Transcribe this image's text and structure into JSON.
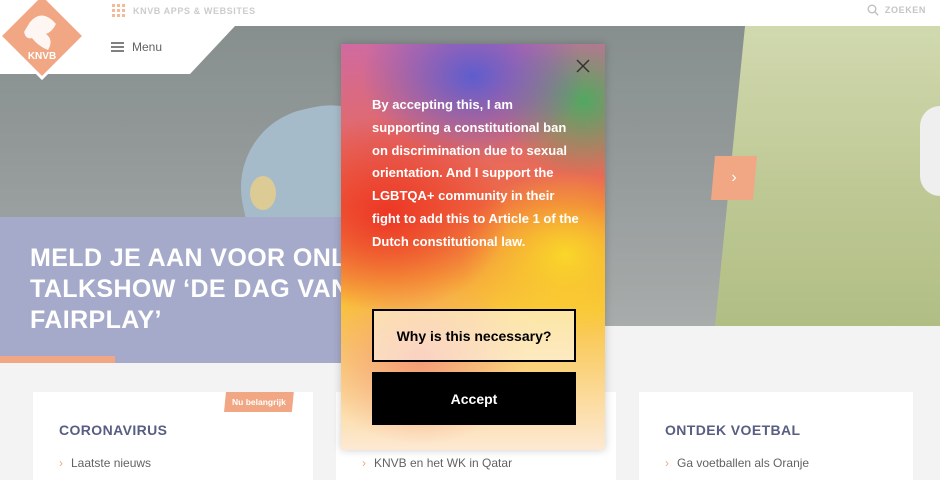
{
  "topbar": {
    "apps_label": "KNVB APPS & WEBSITES",
    "search_label": "ZOEKEN"
  },
  "nav": {
    "menu_label": "Menu",
    "logo_text": "KNVB"
  },
  "hero": {
    "headline": "MELD JE AAN VOOR ONLINE\nTALKSHOW ‘DE DAG VAN\nFAIRPLAY’",
    "next_symbol": "›"
  },
  "cards": [
    {
      "title": "CORONAVIRUS",
      "badge": "Nu belangrijk",
      "link": "Laatste nieuws"
    },
    {
      "title": "",
      "link": "KNVB en het WK in Qatar"
    },
    {
      "title": "ONTDEK VOETBAL",
      "link": "Ga voetballen als Oranje"
    }
  ],
  "popup": {
    "body": "By accepting this, I am supporting a constitutional ban on discrimination due to sexual orientation. And I support the LGBTQA+ community in their fight to add this to Article 1 of the Dutch constitutional law.",
    "why_button": "Why is this necessary?",
    "accept_button": "Accept"
  },
  "colors": {
    "accent_orange": "#f0a07a",
    "headline_bg": "#9ea3c6",
    "card_title": "#4a5178"
  }
}
